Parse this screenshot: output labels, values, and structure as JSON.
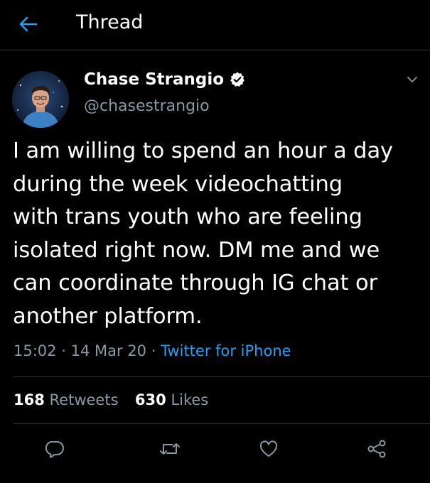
{
  "header": {
    "title": "Thread",
    "back_icon": "arrow-left-icon"
  },
  "colors": {
    "background": "#000000",
    "accent": "#1da1f2",
    "secondary_text": "#8899a6",
    "divider": "#2f3336"
  },
  "tweet": {
    "author": {
      "display_name": "Chase Strangio",
      "handle": "@chasestrangio",
      "verified": true
    },
    "text": "I am willing to spend an hour a day\nduring the week videochatting\nwith trans youth who are feeling\nisolated right now. DM me and we\ncan coordinate through IG chat or\nanother platform.",
    "time": "15:02",
    "date": "14 Mar 20",
    "separator": "·",
    "source": "Twitter for iPhone"
  },
  "stats": {
    "retweets_count": "168",
    "retweets_label": "Retweets",
    "likes_count": "630",
    "likes_label": "Likes"
  },
  "actions": [
    "reply-icon",
    "retweet-icon",
    "like-icon",
    "share-icon"
  ]
}
